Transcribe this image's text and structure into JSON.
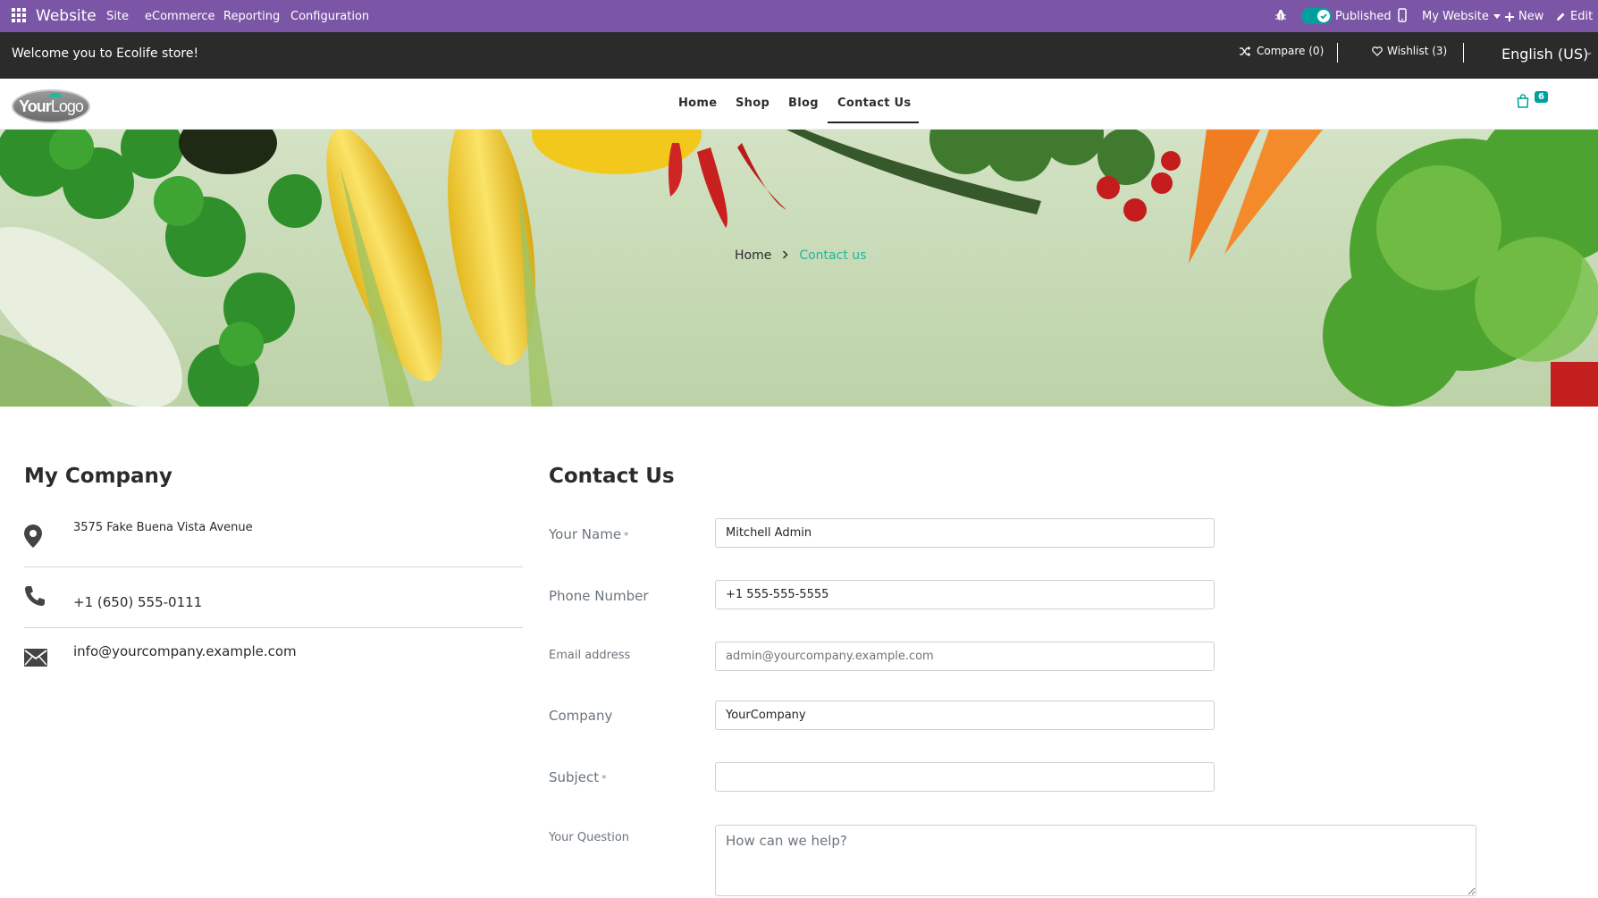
{
  "admin_bar": {
    "app_name": "Website",
    "menu": [
      "Site",
      "eCommerce",
      "Reporting",
      "Configuration"
    ],
    "published_label": "Published",
    "website_label": "My Website",
    "new_label": "New",
    "edit_label": "Edit",
    "accent_color": "#7c56a6"
  },
  "top_header": {
    "welcome": "Welcome you to Ecolife store!",
    "compare": "Compare (0)",
    "wishlist": "Wishlist (3)",
    "language": "English (US)"
  },
  "navbar": {
    "logo_text_bold": "Your",
    "logo_text_thin": "Logo",
    "items": [
      "Home",
      "Shop",
      "Blog",
      "Contact Us"
    ],
    "active_item": "Contact Us",
    "cart_count": "6"
  },
  "hero": {
    "breadcrumb_home": "Home",
    "breadcrumb_current": "Contact us"
  },
  "company": {
    "title": "My Company",
    "address": "3575 Fake Buena Vista Avenue",
    "phone": "+1 (650) 555-0111",
    "email": "info@yourcompany.example.com"
  },
  "contact_form": {
    "title": "Contact Us",
    "name_label": "Your Name",
    "name_value": "Mitchell Admin",
    "phone_label": "Phone Number",
    "phone_value": "+1 555-555-5555",
    "email_label": "Email address",
    "email_placeholder": "admin@yourcompany.example.com",
    "company_label": "Company",
    "company_value": "YourCompany",
    "subject_label": "Subject",
    "subject_value": "",
    "question_label": "Your Question",
    "question_placeholder": "How can we help?",
    "required_marker": "*"
  },
  "colors": {
    "brand_teal": "#21b799",
    "badge_teal": "#00a09d",
    "top_header_bg": "#2b2b2b"
  }
}
